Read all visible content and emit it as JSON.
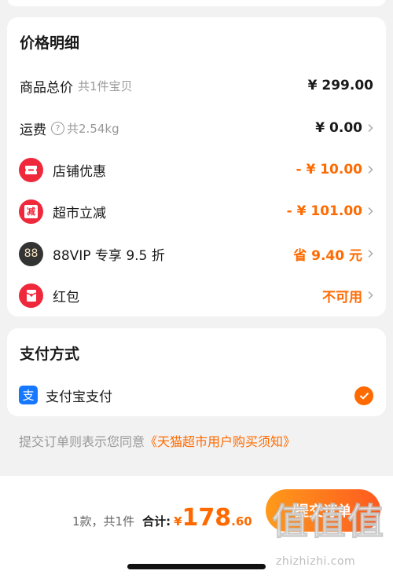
{
  "price_detail": {
    "title": "价格明细",
    "rows": [
      {
        "label": "商品总价",
        "sub": "共1件宝贝",
        "value": "¥ 299.00"
      },
      {
        "label": "运费",
        "sub": "共2.54kg",
        "value": "¥ 0.00"
      },
      {
        "label": "店铺优惠",
        "value": "- ¥ 10.00",
        "icon": "ticket-icon"
      },
      {
        "label": "超市立减",
        "value": "- ¥ 101.00",
        "icon": "reduce-icon",
        "icon_text": "减"
      },
      {
        "label": "88VIP 专享 9.5 折",
        "value": "省 9.40 元",
        "icon": "vip88-icon",
        "icon_text": "88"
      },
      {
        "label": "红包",
        "value": "不可用",
        "icon": "red-packet-icon"
      }
    ]
  },
  "payment": {
    "title": "支付方式",
    "method": "支付宝支付",
    "icon_text": "支",
    "selected": true
  },
  "agreement": {
    "prefix": "提交订单则表示您同意",
    "link": "《天猫超市用户购买须知》"
  },
  "footer": {
    "count": "1款，共1件",
    "total_label": "合计:",
    "currency": "¥",
    "total_int": "178",
    "total_dec": ".60",
    "submit_label": "提交订单"
  },
  "watermark": {
    "text": "值值值",
    "url": "zhizhizhi.com"
  },
  "colors": {
    "accent": "#ff6a00",
    "red_icon": "#f0283c",
    "background": "#f2f2f2"
  }
}
